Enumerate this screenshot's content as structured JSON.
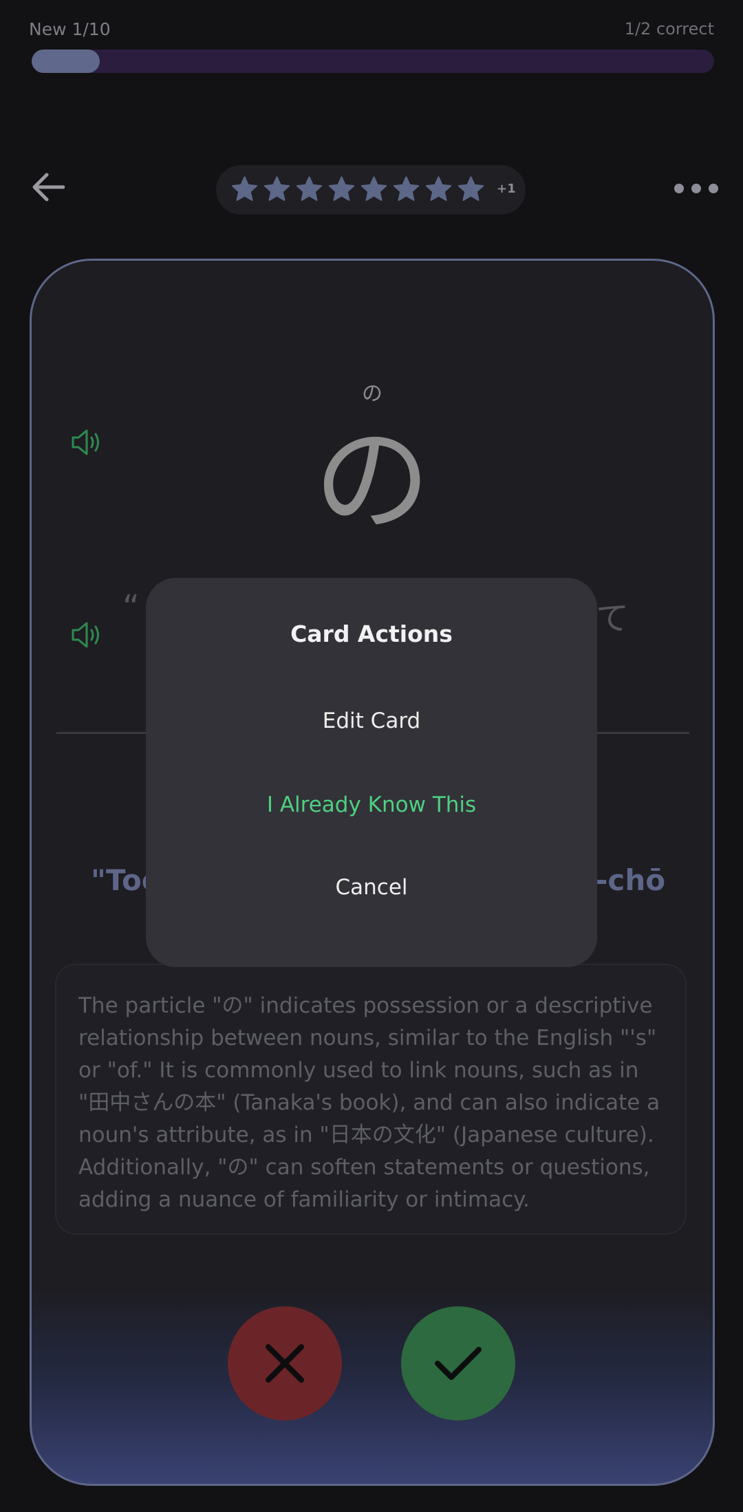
{
  "progress": {
    "label": "New 1/10",
    "correct": "1/2 correct",
    "fraction": 0.1
  },
  "header": {
    "stars_count": 8,
    "extra_badge": "+1",
    "star_color": "#5d6788"
  },
  "card": {
    "reading": "の",
    "kanji": "の",
    "sentence_fragment_left": "“",
    "sentence_fragment_right": "て",
    "translation_left": "\"Too",
    "translation_right": "-chō",
    "explanation": "The particle \"の\" indicates possession or a descriptive relationship between nouns, similar to the English \"'s\" or \"of.\" It is commonly used to link nouns, such as in \"田中さんの本\" (Tanaka's book), and can also indicate a noun's attribute, as in \"日本の文化\" (Japanese culture). Additionally, \"の\" can soften statements or questions, adding a nuance of familiarity or intimacy.",
    "accent_color": "#5e6789"
  },
  "modal": {
    "title": "Card Actions",
    "edit": "Edit Card",
    "already_know": "I Already Know This",
    "cancel": "Cancel",
    "know_color": "#4fd081"
  }
}
